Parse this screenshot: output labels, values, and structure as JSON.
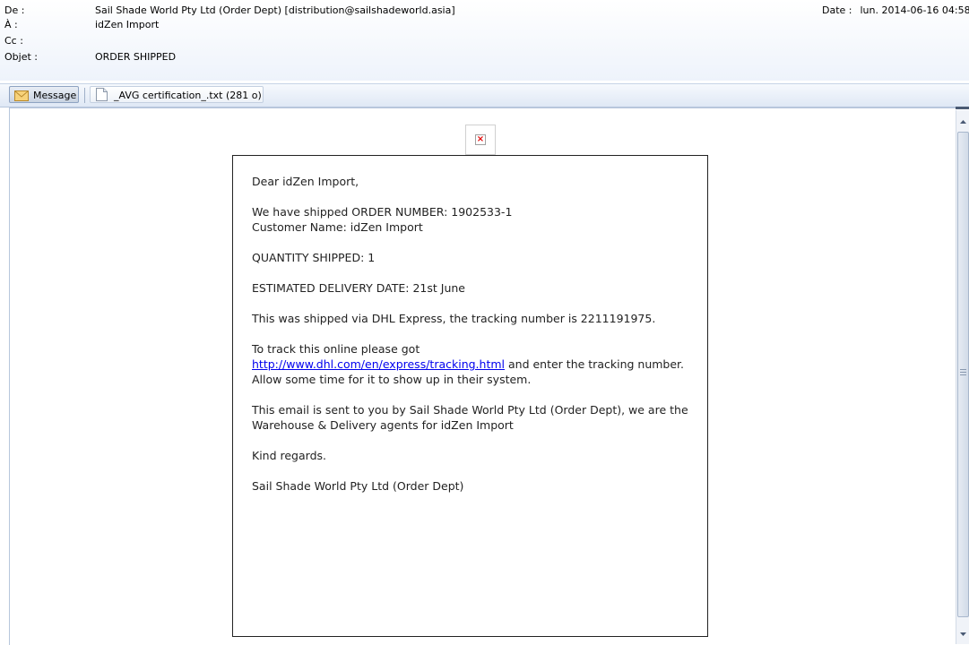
{
  "header": {
    "from_label": "De :",
    "from_value": "Sail Shade World Pty Ltd (Order Dept) [distribution@sailshadeworld.asia]",
    "to_label": "À :",
    "to_value": "idZen Import",
    "cc_label": "Cc :",
    "cc_value": "",
    "subject_label": "Objet :",
    "subject_value": "ORDER SHIPPED",
    "date_label": "Date :",
    "date_value": "lun. 2014-06-16 04:58"
  },
  "tabs": {
    "message_label": "Message",
    "attachment_label": "_AVG certification_.txt (281 o)"
  },
  "icons": {
    "message": "envelope-icon",
    "attachment": "text-file-icon",
    "broken_image": "broken-image-icon"
  },
  "email": {
    "greeting": "Dear idZen Import,",
    "order_line": "We have shipped ORDER NUMBER: 1902533-1",
    "customer_line": "Customer Name: idZen Import",
    "quantity_line": "QUANTITY SHIPPED: 1",
    "delivery_line": "ESTIMATED DELIVERY DATE: 21st June",
    "shipping_line": "This was shipped via DHL Express, the tracking number is 2211191975.",
    "track_prefix": "To track this online please got",
    "track_link": "http://www.dhl.com/en/express/tracking.html",
    "track_suffix": " and enter the tracking number. Allow some time for it to show up in their system.",
    "info_line": "This email is sent to you by Sail Shade World Pty Ltd (Order Dept), we are the Warehouse & Delivery agents for idZen Import",
    "closing": "Kind regards.",
    "signature": "Sail Shade World Pty Ltd (Order Dept)"
  },
  "colors": {
    "link": "#0000ee",
    "header_bg": "#eef3fb",
    "broken_image_x": "#e00000"
  }
}
